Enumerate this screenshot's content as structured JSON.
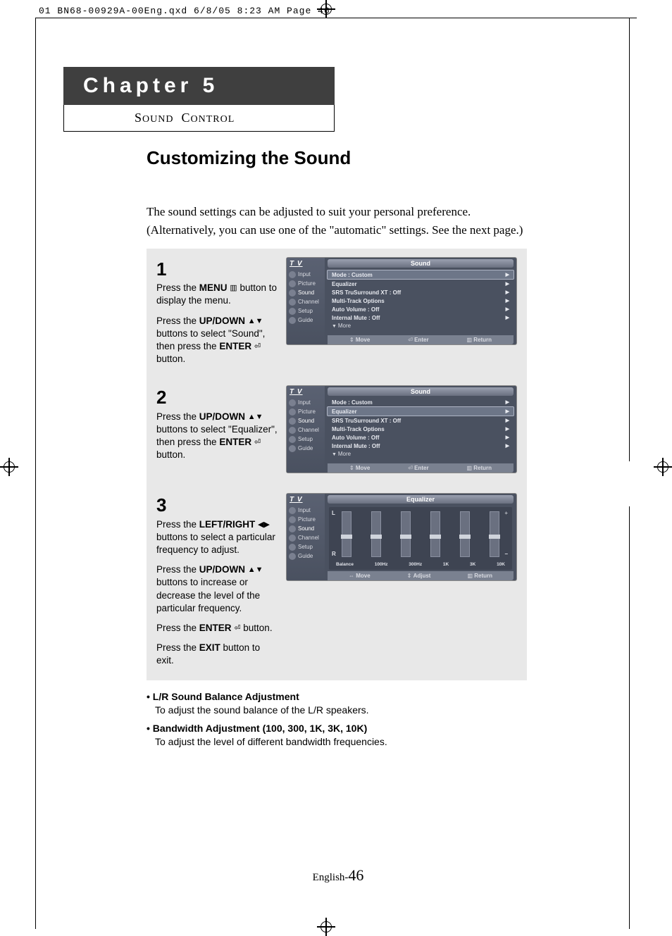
{
  "print_header": "01 BN68-00929A-00Eng.qxd  6/8/05 8:23 AM  Page 46",
  "chapter": {
    "title": "Chapter 5",
    "subtitle": "Sound Control"
  },
  "section_title": "Customizing the Sound",
  "intro_line1": "The sound settings can be adjusted to suit your personal preference.",
  "intro_line2": "(Alternatively, you can use one of the \"automatic\" settings. See the next page.)",
  "steps": [
    {
      "num": "1",
      "paras": [
        {
          "pre": "Press the ",
          "bold": "MENU",
          "glyph": "▥",
          "post": " button to display the menu."
        },
        {
          "pre": "Press the ",
          "bold": "UP/DOWN",
          "glyph": "▲▼",
          "post": " buttons to select \"Sound\", then press the ",
          "bold2": "ENTER",
          "glyph2": "⏎",
          "post2": " button."
        }
      ],
      "osd": {
        "title": "Sound",
        "highlight_index": 0,
        "rows": [
          {
            "label": "Mode",
            "value": ": Custom"
          },
          {
            "label": "Equalizer",
            "value": ""
          },
          {
            "label": "SRS TruSurround XT",
            "value": ": Off"
          },
          {
            "label": "Multi-Track Options",
            "value": ""
          },
          {
            "label": "Auto Volume",
            "value": ": Off"
          },
          {
            "label": "Internal Mute",
            "value": ": Off"
          }
        ],
        "more": "More",
        "footer": [
          {
            "ico": "⇕",
            "txt": "Move"
          },
          {
            "ico": "⏎",
            "txt": "Enter"
          },
          {
            "ico": "▥",
            "txt": "Return"
          }
        ]
      }
    },
    {
      "num": "2",
      "paras": [
        {
          "pre": "Press the ",
          "bold": "UP/DOWN",
          "glyph": "▲▼",
          "post": " buttons to select \"Equalizer\", then press the ",
          "bold2": "ENTER",
          "glyph2": "⏎",
          "post2": " button."
        }
      ],
      "osd": {
        "title": "Sound",
        "highlight_index": 1,
        "rows": [
          {
            "label": "Mode",
            "value": ": Custom"
          },
          {
            "label": "Equalizer",
            "value": ""
          },
          {
            "label": "SRS TruSurround XT",
            "value": ": Off"
          },
          {
            "label": "Multi-Track Options",
            "value": ""
          },
          {
            "label": "Auto Volume",
            "value": ": Off"
          },
          {
            "label": "Internal Mute",
            "value": ": Off"
          }
        ],
        "more": "More",
        "footer": [
          {
            "ico": "⇕",
            "txt": "Move"
          },
          {
            "ico": "⏎",
            "txt": "Enter"
          },
          {
            "ico": "▥",
            "txt": "Return"
          }
        ]
      }
    },
    {
      "num": "3",
      "paras": [
        {
          "pre": "Press the ",
          "bold": "LEFT/RIGHT",
          "glyph": "◀▶",
          "post": " buttons to select a particular frequency to adjust."
        },
        {
          "pre": "Press the ",
          "bold": "UP/DOWN",
          "glyph": "▲▼",
          "post": " buttons to increase or decrease the level of the particular frequency."
        },
        {
          "pre": "Press the ",
          "bold": "ENTER",
          "glyph": "⏎",
          "post": " button."
        },
        {
          "pre": "Press the ",
          "bold": "EXIT",
          "glyph": "",
          "post": " button to exit."
        }
      ],
      "osd_eq": {
        "title": "Equalizer",
        "left_top": "L",
        "left_bot": "R",
        "bands": [
          "Balance",
          "100Hz",
          "300Hz",
          "1K",
          "3K",
          "10K"
        ],
        "footer": [
          {
            "ico": "⇔",
            "txt": "Move"
          },
          {
            "ico": "⇕",
            "txt": "Adjust"
          },
          {
            "ico": "▥",
            "txt": "Return"
          }
        ]
      }
    }
  ],
  "osd_sidebar": {
    "tv": "T V",
    "items": [
      "Input",
      "Picture",
      "Sound",
      "Channel",
      "Setup",
      "Guide"
    ]
  },
  "notes": [
    {
      "title": "L/R Sound Balance Adjustment",
      "body": "To adjust the sound balance of the L/R speakers."
    },
    {
      "title": "Bandwidth Adjustment (100, 300, 1K, 3K, 10K)",
      "body": "To adjust the level of different bandwidth frequencies."
    }
  ],
  "page_number_prefix": "English-",
  "page_number": "46"
}
